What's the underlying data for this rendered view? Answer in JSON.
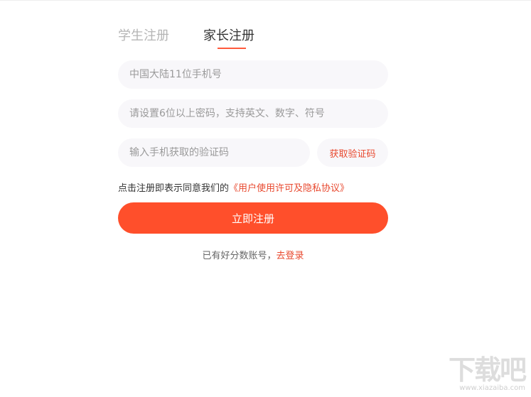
{
  "tabs": {
    "student_label": "学生注册",
    "parent_label": "家长注册"
  },
  "form": {
    "phone_placeholder": "中国大陆11位手机号",
    "password_placeholder": "请设置6位以上密码，支持英文、数字、符号",
    "code_placeholder": "输入手机获取的验证码",
    "get_code_label": "获取验证码",
    "agree_prefix": "点击注册即表示同意我们的",
    "agree_link": "《用户使用许可及隐私协议》",
    "submit_label": "立即注册",
    "login_prefix": "已有好分数账号，",
    "login_link": "去登录"
  },
  "watermark": {
    "logo_text": "下载吧",
    "url": "www.xiazaiba.com"
  },
  "colors": {
    "accent": "#ff4f2b",
    "link": "#e8492f"
  }
}
